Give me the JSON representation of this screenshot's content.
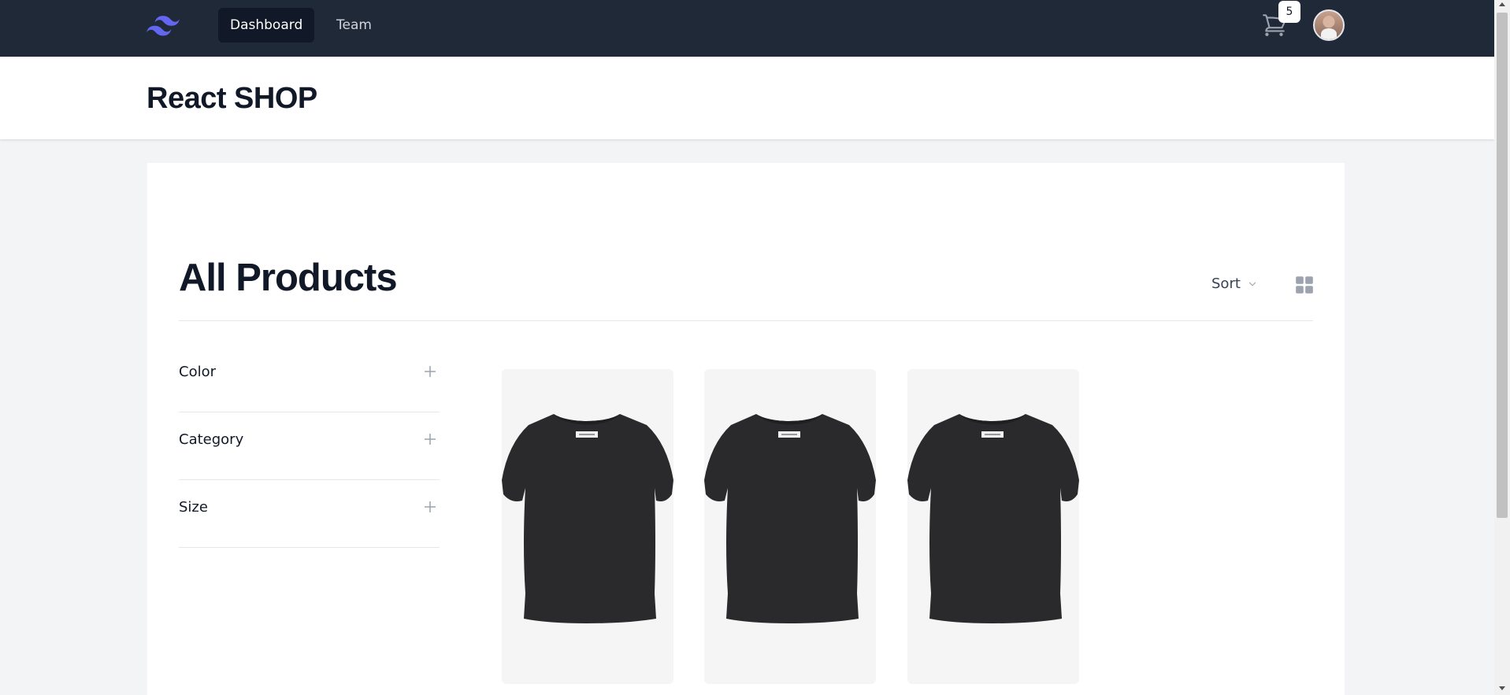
{
  "nav": {
    "logo_icon": "tailwind-logo-icon",
    "links": [
      {
        "label": "Dashboard",
        "active": true
      },
      {
        "label": "Team",
        "active": false
      }
    ],
    "cart_icon": "shopping-cart-icon",
    "cart_count": "5",
    "avatar": "user-avatar"
  },
  "header": {
    "title": "React SHOP"
  },
  "main": {
    "heading": "All Products",
    "sort_label": "Sort",
    "sort_icon": "chevron-down-icon",
    "view_icon": "grid-view-icon"
  },
  "filters": [
    {
      "label": "Color",
      "icon": "plus-icon"
    },
    {
      "label": "Category",
      "icon": "plus-icon"
    },
    {
      "label": "Size",
      "icon": "plus-icon"
    }
  ],
  "products": [
    {
      "image": "black-tshirt-image"
    },
    {
      "image": "black-tshirt-image"
    },
    {
      "image": "black-tshirt-image"
    }
  ],
  "colors": {
    "nav_bg": "#1f2937",
    "active_link_bg": "#111827",
    "logo_accent": "#6366f1",
    "page_bg": "#f3f4f6"
  }
}
